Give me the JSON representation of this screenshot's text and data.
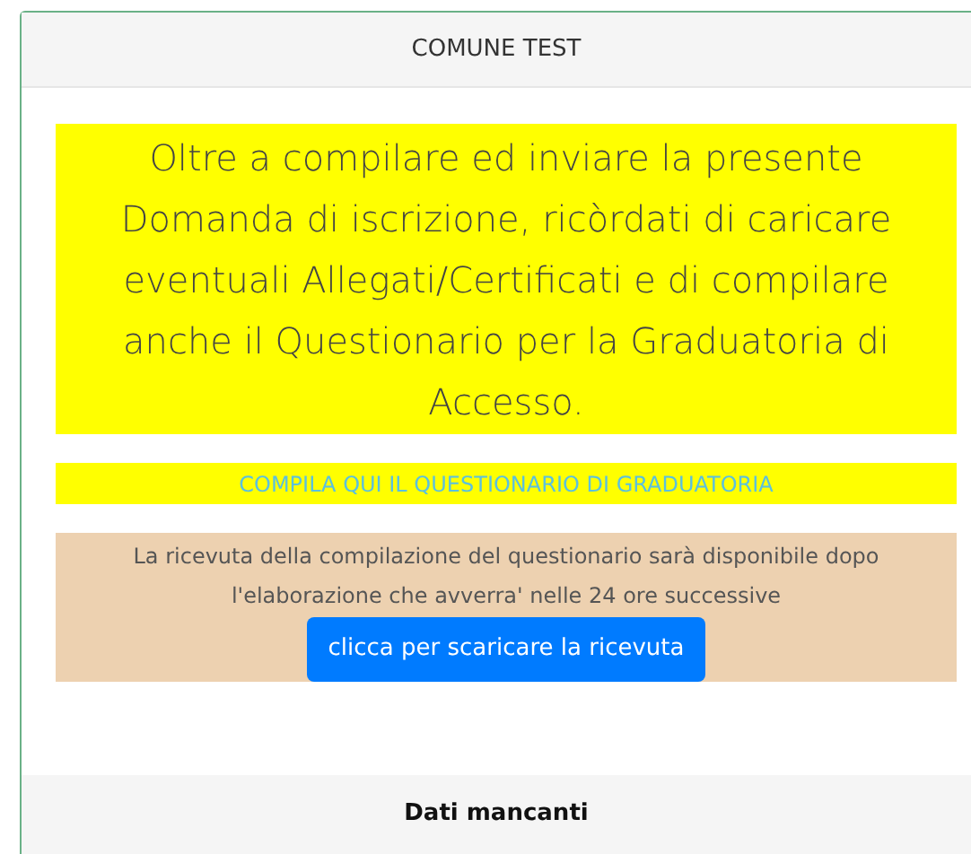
{
  "header": {
    "title": "COMUNE TEST"
  },
  "notice": {
    "text": "Oltre a compilare ed inviare la presente Domanda di iscrizione, ricòrdati di caricare eventuali Allegati/Certificati e di compilare anche il Questionario per la Graduatoria di Accesso."
  },
  "questionnaire_link": {
    "label": "COMPILA QUI IL QUESTIONARIO DI GRADUATORIA"
  },
  "receipt": {
    "text": "La ricevuta della compilazione del questionario sarà disponibile dopo l'elaborazione che avverra' nelle 24 ore successive",
    "button": "clicca per scaricare la ricevuta"
  },
  "footer": {
    "title": "Dati mancanti"
  }
}
